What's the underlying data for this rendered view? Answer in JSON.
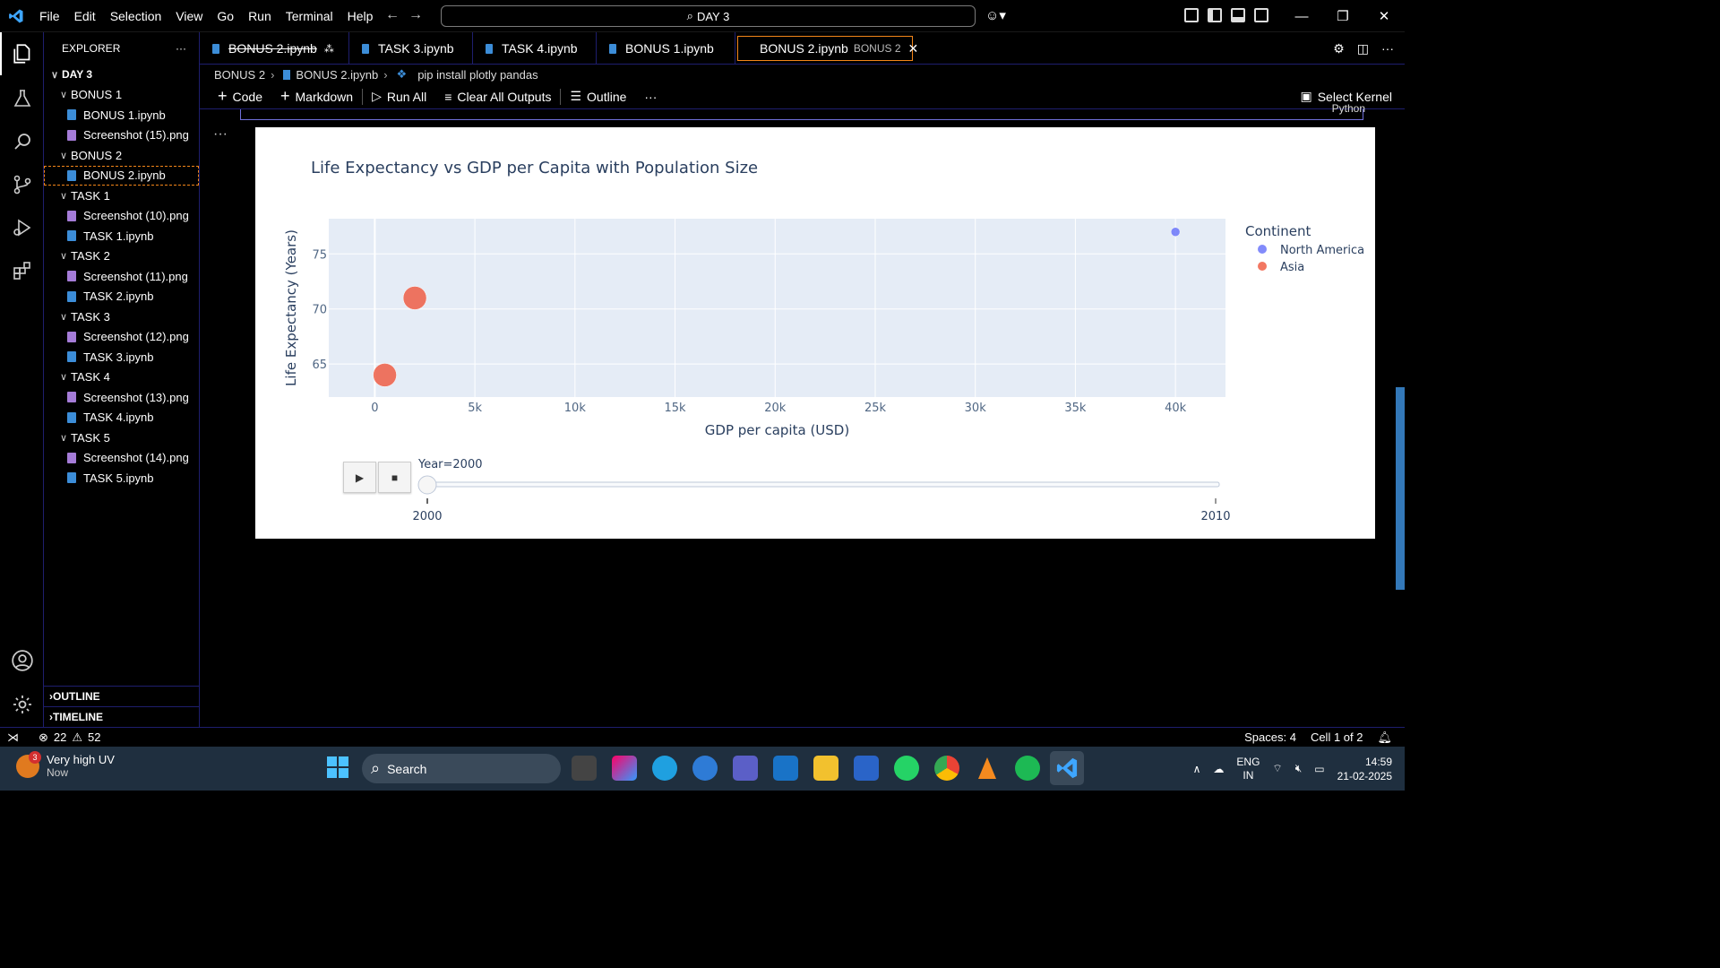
{
  "menu": [
    "File",
    "Edit",
    "Selection",
    "View",
    "Go",
    "Run",
    "Terminal",
    "Help"
  ],
  "command_center": "DAY 3",
  "explorer": {
    "title": "EXPLORER",
    "root": "DAY 3",
    "tree": [
      {
        "type": "folder",
        "label": "BONUS 1"
      },
      {
        "type": "nb",
        "label": "BONUS 1.ipynb"
      },
      {
        "type": "img",
        "label": "Screenshot (15).png"
      },
      {
        "type": "folder",
        "label": "BONUS 2"
      },
      {
        "type": "nb",
        "label": "BONUS 2.ipynb",
        "selected": true
      },
      {
        "type": "folder",
        "label": "TASK 1"
      },
      {
        "type": "img",
        "label": "Screenshot (10).png"
      },
      {
        "type": "nb",
        "label": "TASK 1.ipynb"
      },
      {
        "type": "folder",
        "label": "TASK 2"
      },
      {
        "type": "img",
        "label": "Screenshot (11).png"
      },
      {
        "type": "nb",
        "label": "TASK 2.ipynb"
      },
      {
        "type": "folder",
        "label": "TASK 3"
      },
      {
        "type": "img",
        "label": "Screenshot (12).png"
      },
      {
        "type": "nb",
        "label": "TASK 3.ipynb"
      },
      {
        "type": "folder",
        "label": "TASK 4"
      },
      {
        "type": "img",
        "label": "Screenshot (13).png"
      },
      {
        "type": "nb",
        "label": "TASK 4.ipynb"
      },
      {
        "type": "folder",
        "label": "TASK 5"
      },
      {
        "type": "img",
        "label": "Screenshot (14).png"
      },
      {
        "type": "nb",
        "label": "TASK 5.ipynb"
      }
    ],
    "outline": "OUTLINE",
    "timeline": "TIMELINE"
  },
  "tabs": [
    {
      "label": "BONUS 2.ipynb",
      "strikethrough": true
    },
    {
      "label": "TASK 3.ipynb"
    },
    {
      "label": "TASK 4.ipynb"
    },
    {
      "label": "BONUS 1.ipynb"
    },
    {
      "label": "BONUS 2.ipynb",
      "desc": "BONUS 2",
      "active": true
    }
  ],
  "breadcrumb": [
    "BONUS 2",
    "BONUS 2.ipynb",
    "pip install plotly pandas"
  ],
  "toolbar": {
    "code": "Code",
    "markdown": "Markdown",
    "run_all": "Run All",
    "clear_outputs": "Clear All Outputs",
    "outline": "Outline",
    "kernel": "Select Kernel"
  },
  "cell_language": "Python",
  "chart_data": {
    "type": "scatter",
    "title": "Life Expectancy vs GDP per Capita with Population Size",
    "xlabel": "GDP per capita (USD)",
    "ylabel": "Life Expectancy (Years)",
    "xlim": [
      -2300,
      42500
    ],
    "ylim": [
      62.0,
      78.2
    ],
    "xticks": [
      0,
      5000,
      10000,
      15000,
      20000,
      25000,
      30000,
      35000,
      40000
    ],
    "xtick_labels": [
      "0",
      "5k",
      "10k",
      "15k",
      "20k",
      "25k",
      "30k",
      "35k",
      "40k"
    ],
    "yticks": [
      65,
      70,
      75
    ],
    "legend_title": "Continent",
    "legend_position": "right",
    "series": [
      {
        "name": "North America",
        "color": "#636efa",
        "points": [
          {
            "x": 40000,
            "y": 77.0,
            "size": "small"
          }
        ]
      },
      {
        "name": "Asia",
        "color": "#ef553b",
        "points": [
          {
            "x": 500,
            "y": 64.0,
            "size": "large"
          },
          {
            "x": 2000,
            "y": 71.0,
            "size": "large"
          }
        ]
      }
    ],
    "slider": {
      "label": "Year=2000",
      "ticks": [
        "2000",
        "2010"
      ],
      "value": 2000
    }
  },
  "status": {
    "errors": "22",
    "warnings": "52",
    "spaces": "Spaces: 4",
    "cell": "Cell 1 of 2"
  },
  "taskbar": {
    "weather_title": "Very high UV",
    "weather_sub": "Now",
    "weather_badge": "3",
    "search": "Search",
    "lang_top": "ENG",
    "lang_bottom": "IN",
    "time": "14:59",
    "date": "21-02-2025"
  }
}
